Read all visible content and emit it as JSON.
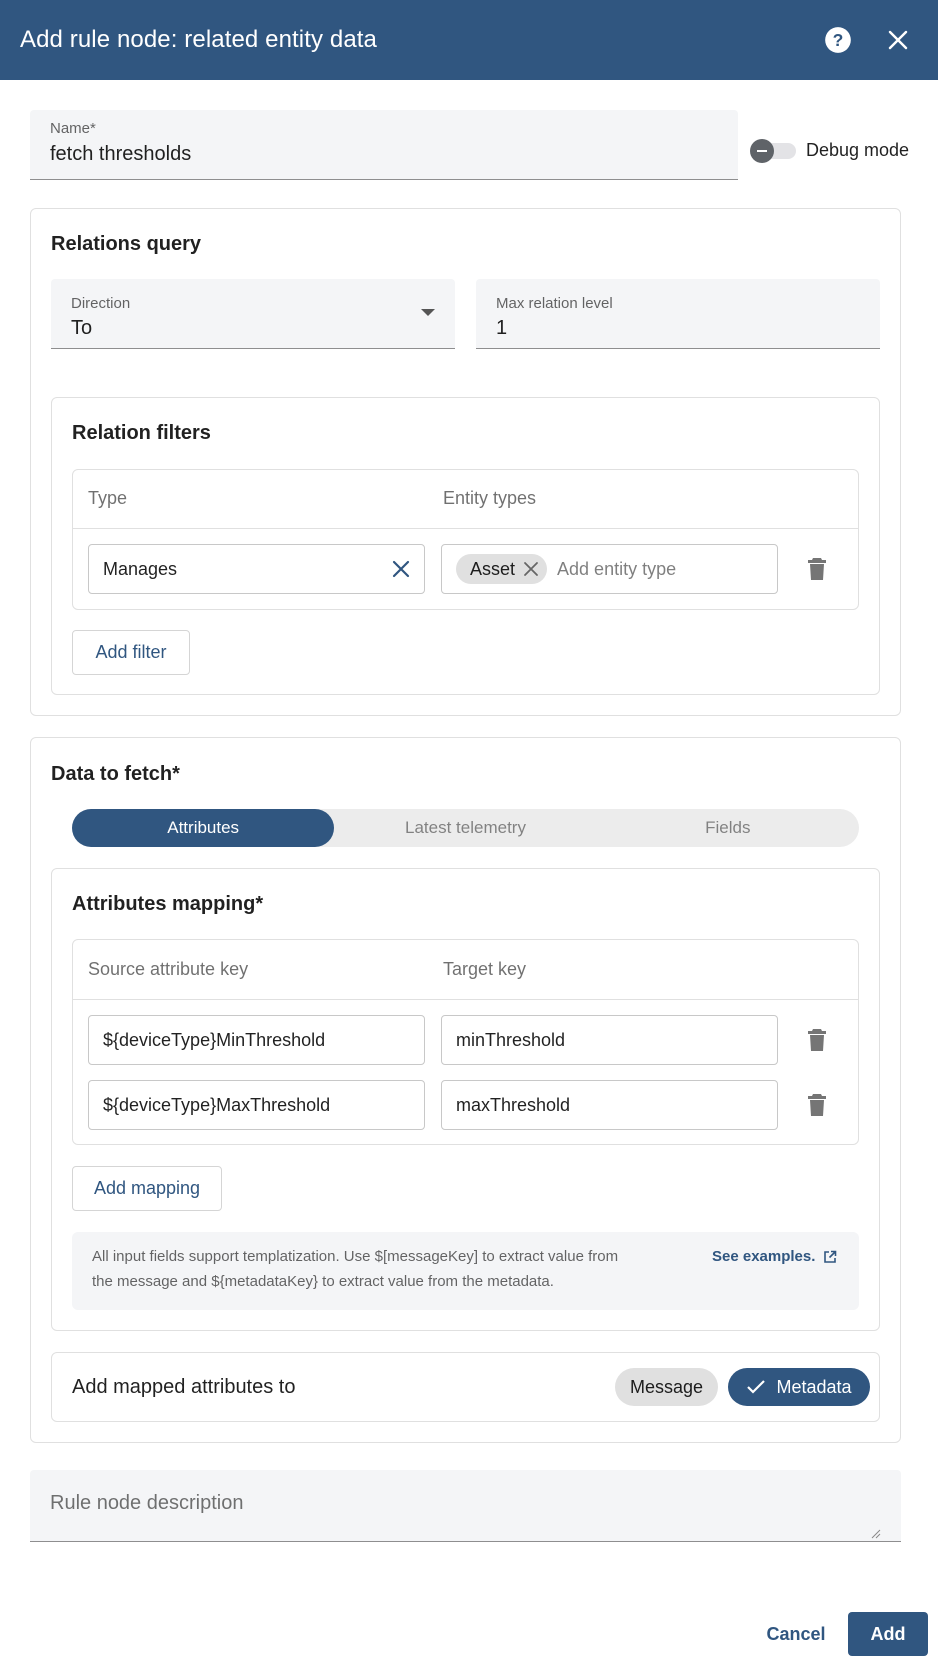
{
  "dialog": {
    "title": "Add rule node: related entity data",
    "help_icon": "help-circle-icon",
    "close_icon": "close-icon"
  },
  "name_field": {
    "label": "Name*",
    "value": "fetch thresholds"
  },
  "debug_mode": {
    "label": "Debug mode",
    "enabled": false
  },
  "relations_query": {
    "title": "Relations query",
    "direction": {
      "label": "Direction",
      "value": "To"
    },
    "max_level": {
      "label": "Max relation level",
      "value": "1"
    },
    "filters": {
      "title": "Relation filters",
      "headers": {
        "type": "Type",
        "entity_types": "Entity types"
      },
      "rows": [
        {
          "type": "Manages",
          "chips": [
            "Asset"
          ],
          "placeholder": "Add entity type"
        }
      ],
      "add_button": "Add filter"
    }
  },
  "data_to_fetch": {
    "title": "Data to fetch*",
    "tabs": [
      "Attributes",
      "Latest telemetry",
      "Fields"
    ],
    "active_tab": "Attributes",
    "mapping": {
      "title": "Attributes mapping*",
      "headers": {
        "source": "Source attribute key",
        "target": "Target key"
      },
      "rows": [
        {
          "source": "${deviceType}MinThreshold",
          "target": "minThreshold"
        },
        {
          "source": "${deviceType}MaxThreshold",
          "target": "maxThreshold"
        }
      ],
      "add_button": "Add mapping"
    },
    "info": {
      "line1": "All input fields support templatization. Use $[messageKey] to extract value from",
      "line2": "the message and ${metadataKey} to extract value from the metadata.",
      "link": "See examples."
    },
    "add_to": {
      "label": "Add mapped attributes to",
      "options": [
        "Message",
        "Metadata"
      ],
      "selected": "Metadata"
    }
  },
  "description": {
    "placeholder": "Rule node description"
  },
  "footer": {
    "cancel": "Cancel",
    "add": "Add"
  },
  "colors": {
    "primary": "#305680",
    "surface": "#f4f5f7",
    "border": "#e0e0e0"
  }
}
